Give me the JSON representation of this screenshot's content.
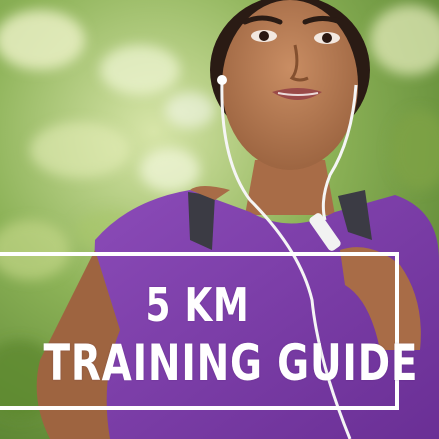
{
  "poster": {
    "headline_line1": "5 KM",
    "headline_line2": "TRAINING GUIDE"
  },
  "colors": {
    "shirt_purple": "#7a3aa6",
    "foliage_green": "#7fa84a",
    "skin": "#b57a55",
    "text": "#ffffff"
  }
}
